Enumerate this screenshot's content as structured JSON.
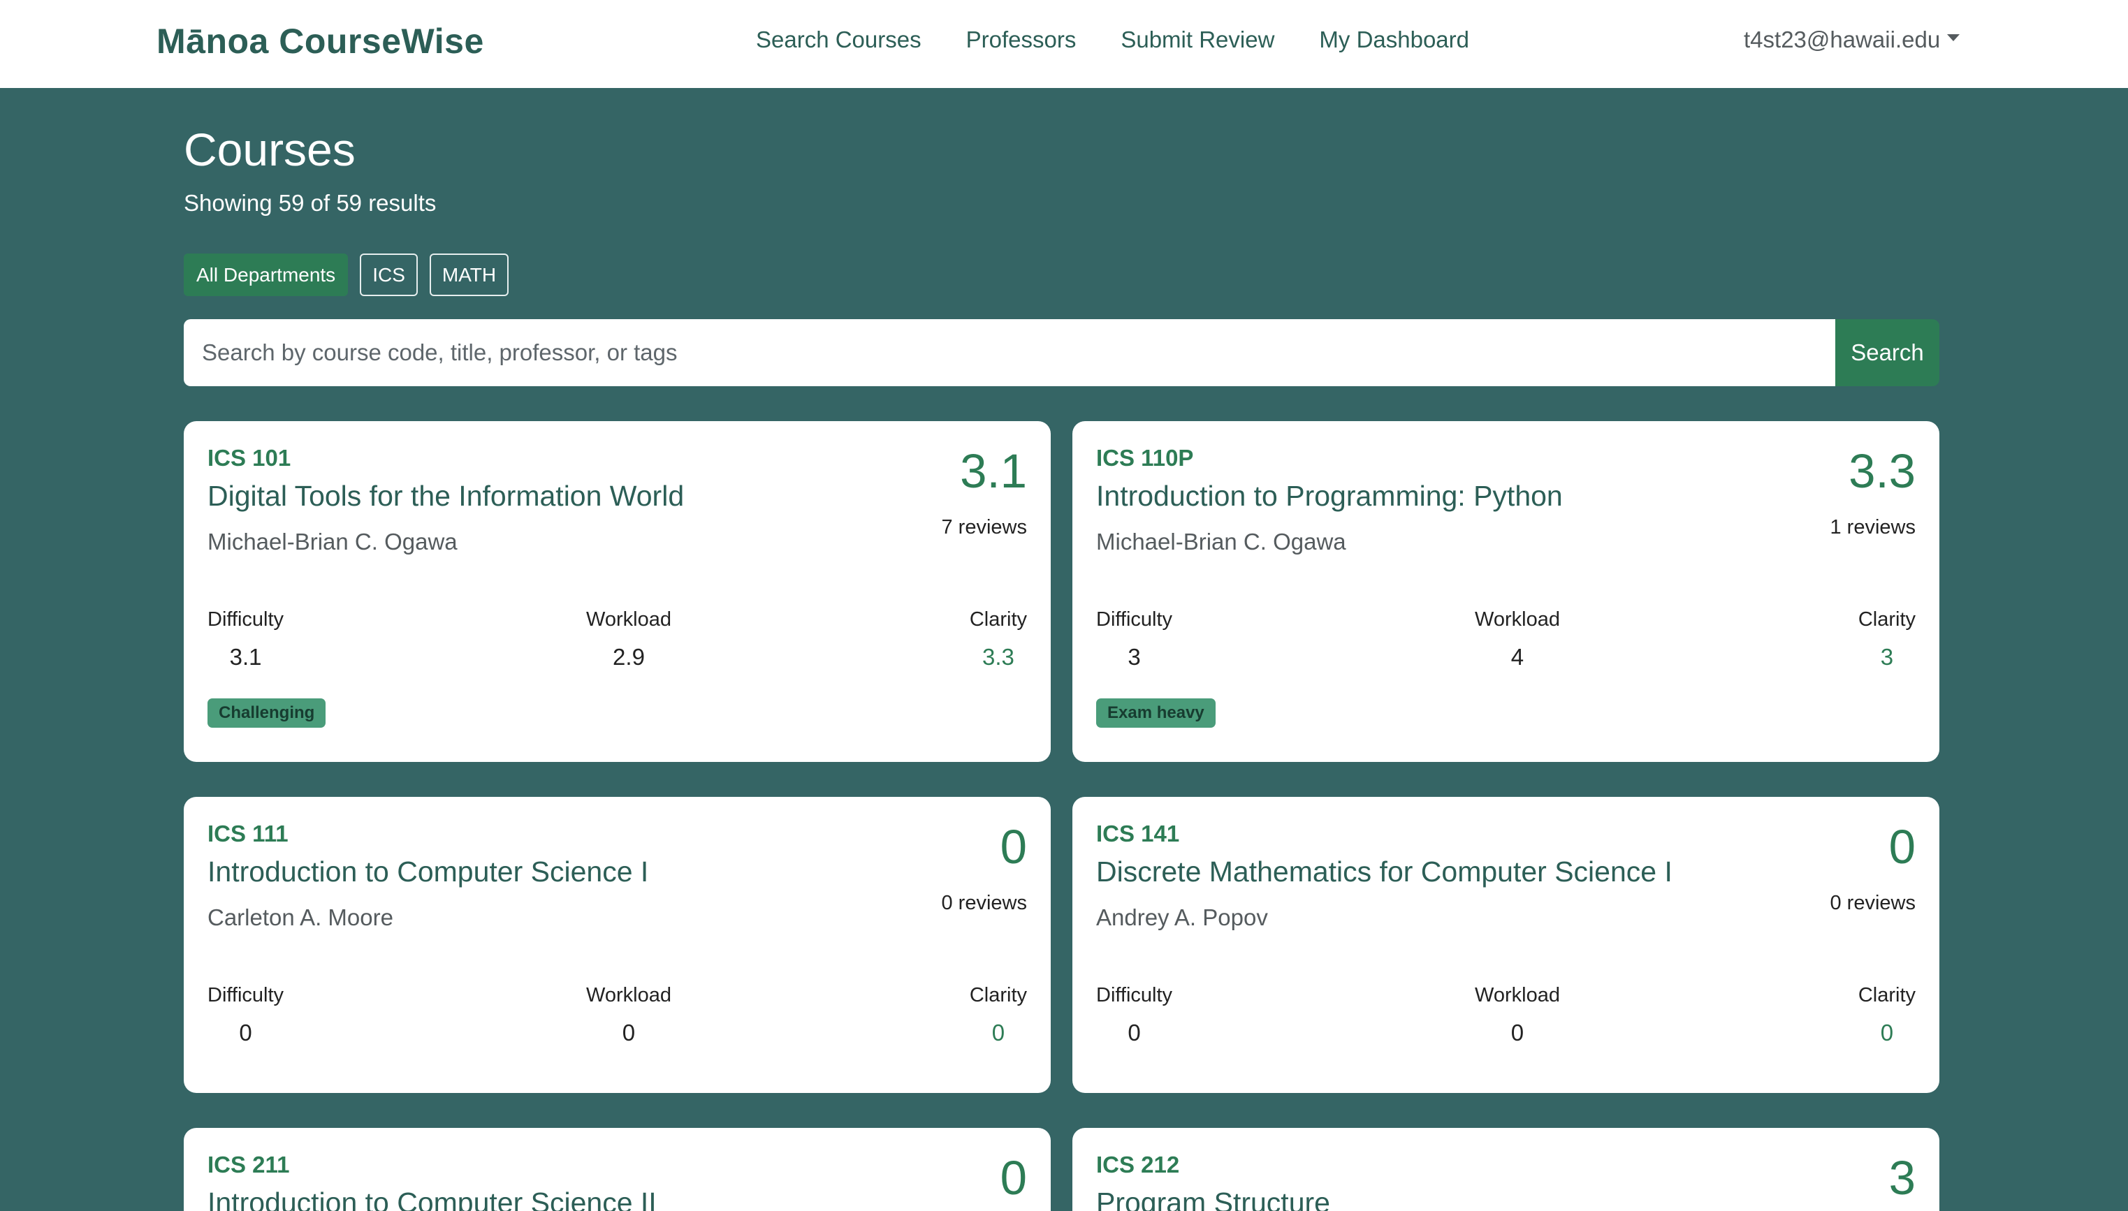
{
  "navbar": {
    "brand": "Mānoa CourseWise",
    "links": [
      "Search Courses",
      "Professors",
      "Submit Review",
      "My Dashboard"
    ],
    "user_email": "t4st23@hawaii.edu"
  },
  "header": {
    "title": "Courses",
    "results_text": "Showing 59 of 59 results"
  },
  "filters": [
    {
      "label": "All Departments",
      "active": true
    },
    {
      "label": "ICS",
      "active": false
    },
    {
      "label": "MATH",
      "active": false
    }
  ],
  "search": {
    "placeholder": "Search by course code, title, professor, or tags",
    "value": "",
    "button_label": "Search"
  },
  "metric_labels": {
    "difficulty": "Difficulty",
    "workload": "Workload",
    "clarity": "Clarity"
  },
  "courses": [
    {
      "code": "ICS 101",
      "title": "Digital Tools for the Information World",
      "professor": "Michael-Brian C. Ogawa",
      "rating": "3.1",
      "reviews": "7 reviews",
      "difficulty": "3.1",
      "workload": "2.9",
      "clarity": "3.3",
      "tag": "Challenging"
    },
    {
      "code": "ICS 110P",
      "title": "Introduction to Programming: Python",
      "professor": "Michael-Brian C. Ogawa",
      "rating": "3.3",
      "reviews": "1 reviews",
      "difficulty": "3",
      "workload": "4",
      "clarity": "3",
      "tag": "Exam heavy"
    },
    {
      "code": "ICS 111",
      "title": "Introduction to Computer Science I",
      "professor": "Carleton A. Moore",
      "rating": "0",
      "reviews": "0 reviews",
      "difficulty": "0",
      "workload": "0",
      "clarity": "0"
    },
    {
      "code": "ICS 141",
      "title": "Discrete Mathematics for Computer Science I",
      "professor": "Andrey A. Popov",
      "rating": "0",
      "reviews": "0 reviews",
      "difficulty": "0",
      "workload": "0",
      "clarity": "0"
    },
    {
      "code": "ICS 211",
      "title": "Introduction to Computer Science II",
      "rating": "0"
    },
    {
      "code": "ICS 212",
      "title": "Program Structure",
      "rating": "3"
    }
  ],
  "colors": {
    "page_bg": "#356565",
    "accent_green": "#2d7c55",
    "brand_text": "#2c5e56",
    "tag_bg": "#4a9c7a"
  }
}
